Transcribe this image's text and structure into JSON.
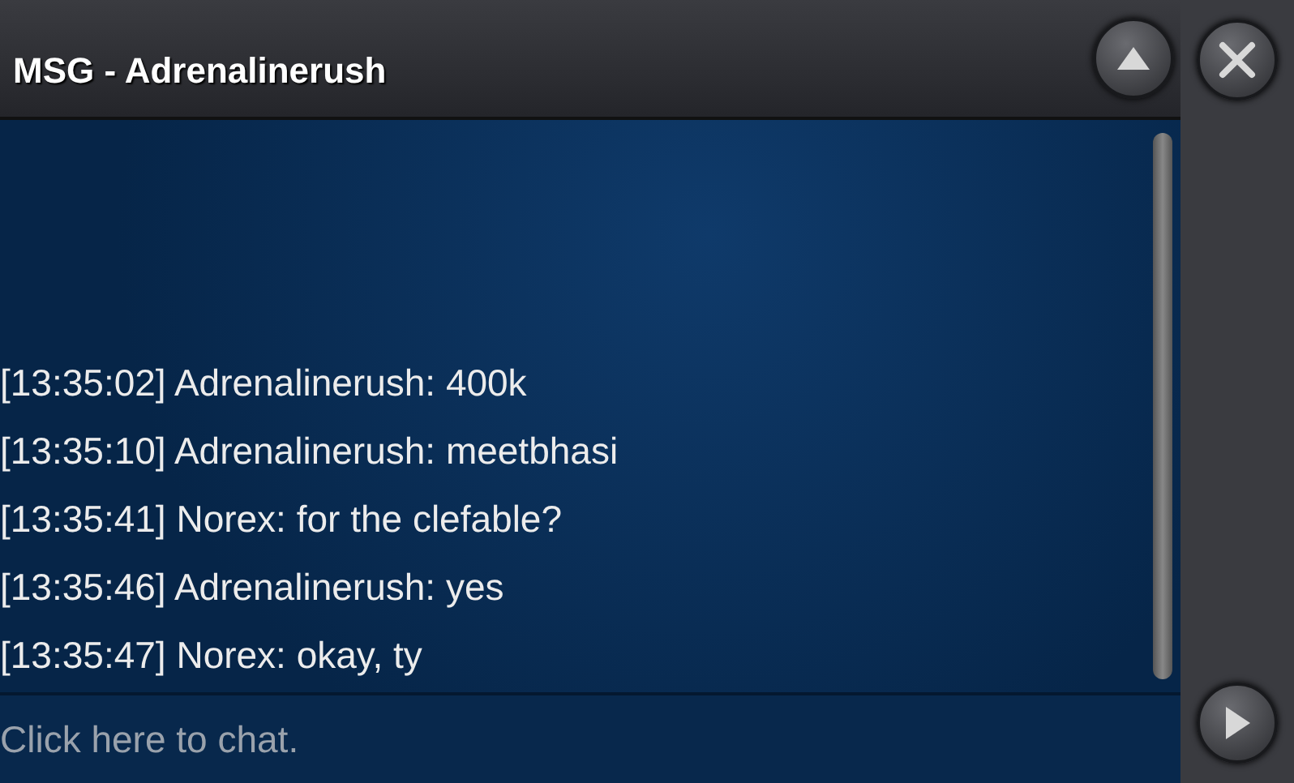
{
  "window": {
    "title": "MSG - Adrenalinerush"
  },
  "messages": [
    {
      "time": "[13:35:02]",
      "sender": "Adrenalinerush:",
      "text": "400k"
    },
    {
      "time": "[13:35:10]",
      "sender": "Adrenalinerush:",
      "text": "meetbhasi"
    },
    {
      "time": "[13:35:41]",
      "sender": "Norex:",
      "text": "for the clefable?"
    },
    {
      "time": "[13:35:46]",
      "sender": "Adrenalinerush:",
      "text": "yes"
    },
    {
      "time": "[13:35:47]",
      "sender": "Norex:",
      "text": "okay, ty"
    }
  ],
  "input": {
    "placeholder": "Click here to chat."
  }
}
